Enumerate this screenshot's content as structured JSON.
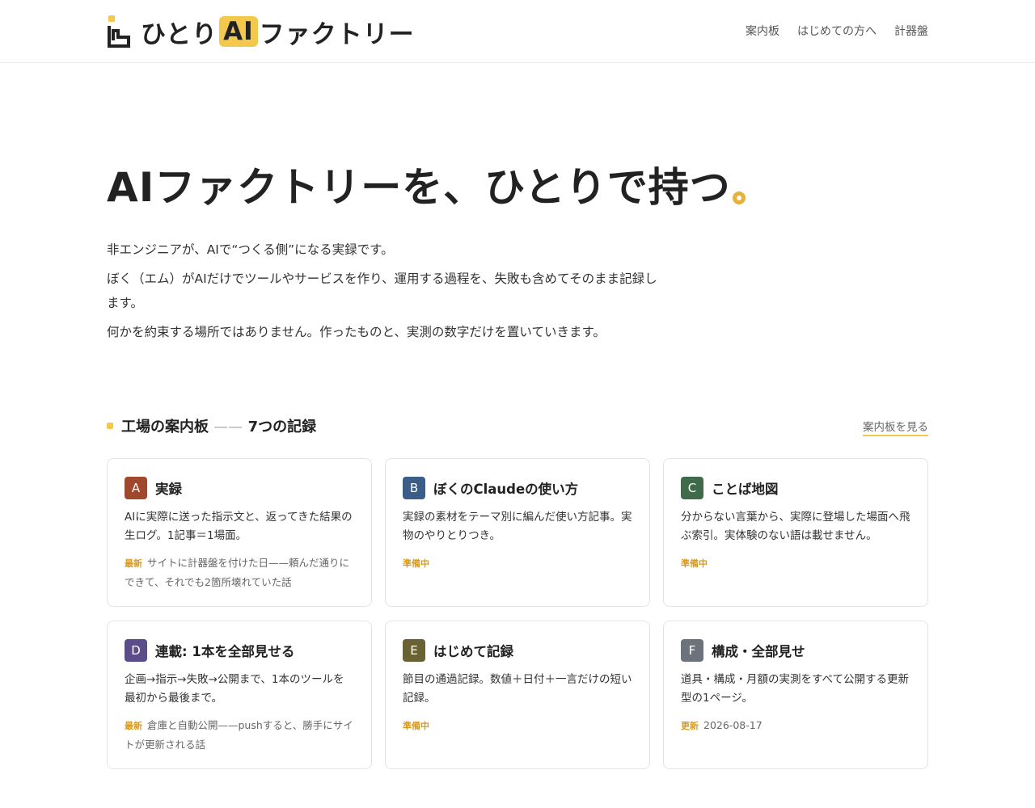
{
  "header": {
    "logo_text_before": "ひとり",
    "logo_text_ai": "AI",
    "logo_text_after": "ファクトリー",
    "nav": [
      {
        "label": "案内板"
      },
      {
        "label": "はじめての方へ"
      },
      {
        "label": "計器盤"
      }
    ]
  },
  "hero": {
    "title": "AIファクトリーを、ひとりで持つ",
    "accent_color": "#e8b23a"
  },
  "intro": {
    "p1": "非エンジニアが、AIで“つくる側”になる実録です。",
    "p2": "ぼく（エム）がAIだけでツールやサービスを作り、運用する過程を、失敗も含めてそのまま記録します。",
    "p3": "何かを約束する場所ではありません。作ったものと、実測の数字だけを置いていきます。"
  },
  "section": {
    "title_main": "工場の案内板",
    "title_dash": "——",
    "title_sub": "7つの記録",
    "link_label": "案内板を見る"
  },
  "cards": [
    {
      "letter": "A",
      "color": "#a0472c",
      "title": "実録",
      "desc": "AIに実際に送った指示文と、返ってきた結果の生ログ。1記事＝1場面。",
      "tag": "最新",
      "meta": "サイトに計器盤を付けた日——頼んだ通りにできて、それでも2箇所壊れていた話"
    },
    {
      "letter": "B",
      "color": "#3a5d8a",
      "title": "ぼくのClaudeの使い方",
      "desc": "実録の素材をテーマ別に編んだ使い方記事。実物のやりとりつき。",
      "tag": "準備中",
      "meta": ""
    },
    {
      "letter": "C",
      "color": "#3f6b4a",
      "title": "ことば地図",
      "desc": "分からない言葉から、実際に登場した場面へ飛ぶ索引。実体験のない語は載せません。",
      "tag": "準備中",
      "meta": ""
    },
    {
      "letter": "D",
      "color": "#5b4d8a",
      "title": "連載: 1本を全部見せる",
      "desc": "企画→指示→失敗→公開まで、1本のツールを最初から最後まで。",
      "tag": "最新",
      "meta": "倉庫と自動公開——pushすると、勝手にサイトが更新される話"
    },
    {
      "letter": "E",
      "color": "#6b6234",
      "title": "はじめて記録",
      "desc": "節目の通過記録。数値＋日付＋一言だけの短い記録。",
      "tag": "準備中",
      "meta": ""
    },
    {
      "letter": "F",
      "color": "#6d737c",
      "title": "構成・全部見せ",
      "desc": "道具・構成・月額の実測をすべて公開する更新型の1ページ。",
      "tag": "更新",
      "meta": "2026-08-17"
    }
  ]
}
